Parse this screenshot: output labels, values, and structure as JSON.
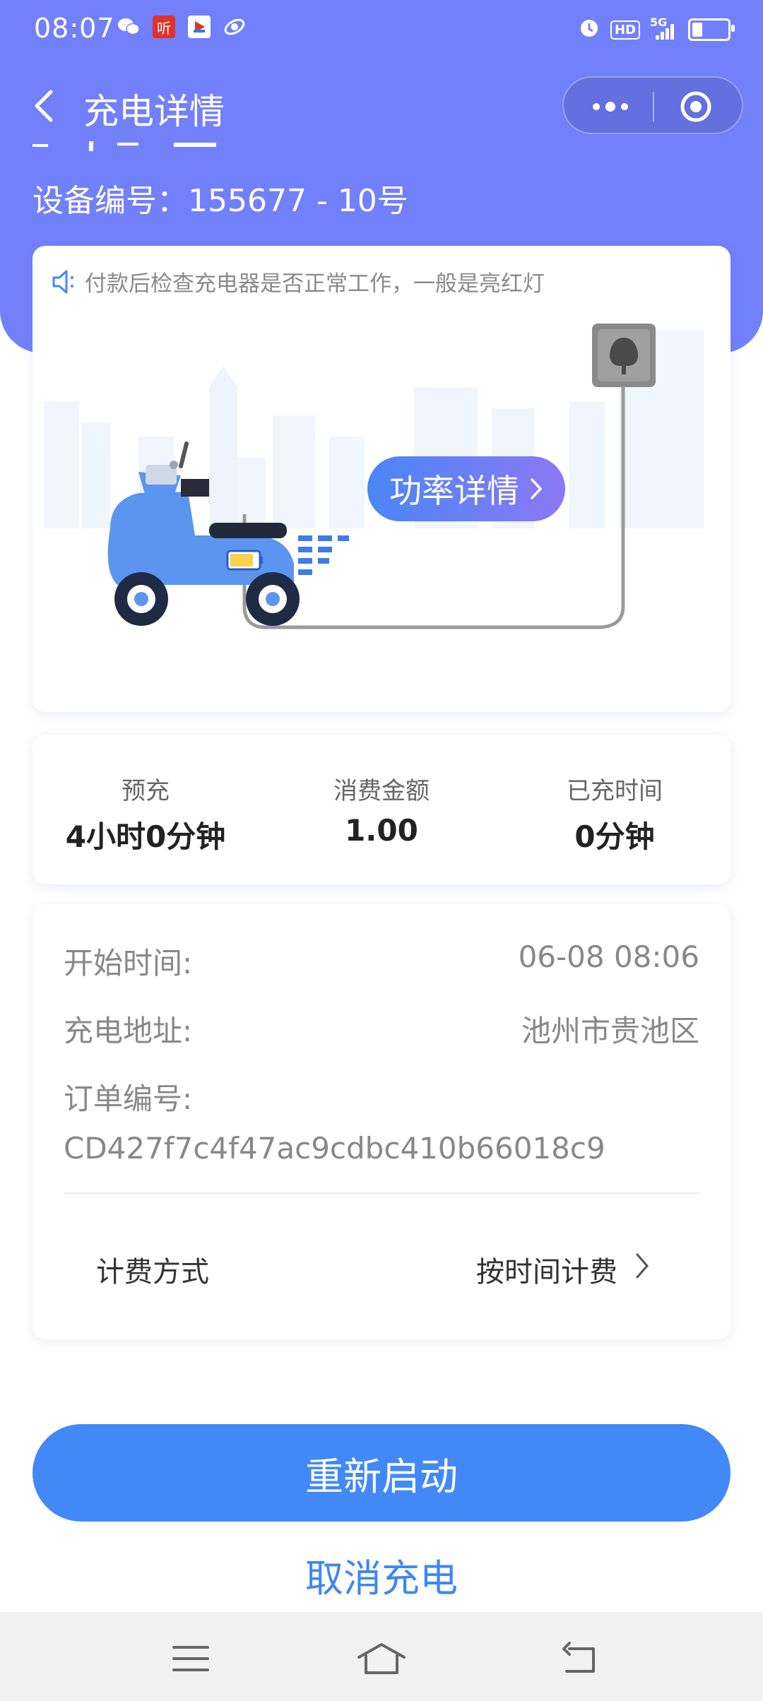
{
  "status_bar": {
    "time": "08:07",
    "left_icons": [
      "wechat-icon",
      "listen-app-icon",
      "video-app-icon",
      "browser-app-icon"
    ],
    "listen_label": "听",
    "right_icons": [
      "alarm-icon",
      "hd-icon",
      "5g-signal-icon",
      "battery-icon"
    ],
    "hd_label": "HD",
    "network": "5G"
  },
  "nav": {
    "title": "充电详情"
  },
  "device": {
    "number_label": "设备编号：155677 - 10号"
  },
  "illustration": {
    "notice": "付款后检查充电器是否正常工作，一般是亮红灯",
    "power_button": "功率详情"
  },
  "stats": [
    {
      "label": "预充",
      "value": "4小时0分钟"
    },
    {
      "label": "消费金额",
      "value": "1.00"
    },
    {
      "label": "已充时间",
      "value": "0分钟"
    }
  ],
  "order": {
    "start_time_label": "开始时间:",
    "start_time": "06-08 08:06",
    "address_label": "充电地址:",
    "address": "池州市贵池区",
    "order_no_label": "订单编号:",
    "order_no": "CD427f7c4f47ac9cdbc410b66018c9",
    "billing_label": "计费方式",
    "billing_value": "按时间计费"
  },
  "actions": {
    "restart": "重新启动",
    "cancel": "取消充电"
  },
  "colors": {
    "header": "#7280fb",
    "primary": "#4289f7",
    "link": "#3e86f5"
  }
}
